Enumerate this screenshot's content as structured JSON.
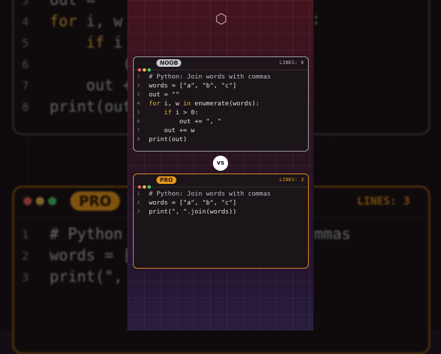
{
  "noob": {
    "badge": "NOOB",
    "lines_label": "LINES: 8",
    "code": [
      {
        "n": "1",
        "t": "# Python: Join words with commas"
      },
      {
        "n": "2",
        "t": "words = [\"a\", \"b\", \"c\"]"
      },
      {
        "n": "3",
        "t": "out = \"\""
      },
      {
        "n": "4",
        "t": "for i, w in enumerate(words):"
      },
      {
        "n": "5",
        "t": "    if i > 0:"
      },
      {
        "n": "6",
        "t": "        out += \", \""
      },
      {
        "n": "7",
        "t": "    out += w"
      },
      {
        "n": "8",
        "t": "print(out)"
      }
    ]
  },
  "pro": {
    "badge": "PRO",
    "lines_label": "LINES: 3",
    "code": [
      {
        "n": "1",
        "t": "# Python: Join words with commas"
      },
      {
        "n": "2",
        "t": "words = [\"a\", \"b\", \"c\"]"
      },
      {
        "n": "3",
        "t": "print(\", \".join(words))"
      }
    ]
  },
  "vs_label": "vs",
  "logo_glyph": "⬡",
  "background": {
    "top_code": [
      {
        "n": "3",
        "t": "out = "
      },
      {
        "n": "4",
        "t": "for i, w"
      },
      {
        "n": "5",
        "t": "    if i"
      },
      {
        "n": "6",
        "t": "        ("
      },
      {
        "n": "7",
        "t": "    out +"
      },
      {
        "n": "8",
        "t": "print(out"
      }
    ],
    "top_code_right": [
      ":"
    ],
    "pro_badge": "PRO",
    "pro_lines": "LINES: 3",
    "bottom_code": [
      {
        "n": "1",
        "t": "# Python",
        "r": "mmas"
      },
      {
        "n": "2",
        "t": "words = [",
        "r": ""
      },
      {
        "n": "3",
        "t": "print(\",",
        "r": ""
      }
    ]
  },
  "colors": {
    "dot_red": "#e35d5b",
    "dot_yellow": "#e6b64a",
    "dot_green": "#4ec46b",
    "pro_accent": "#e48f1c",
    "keyword": "#f2b53a"
  }
}
